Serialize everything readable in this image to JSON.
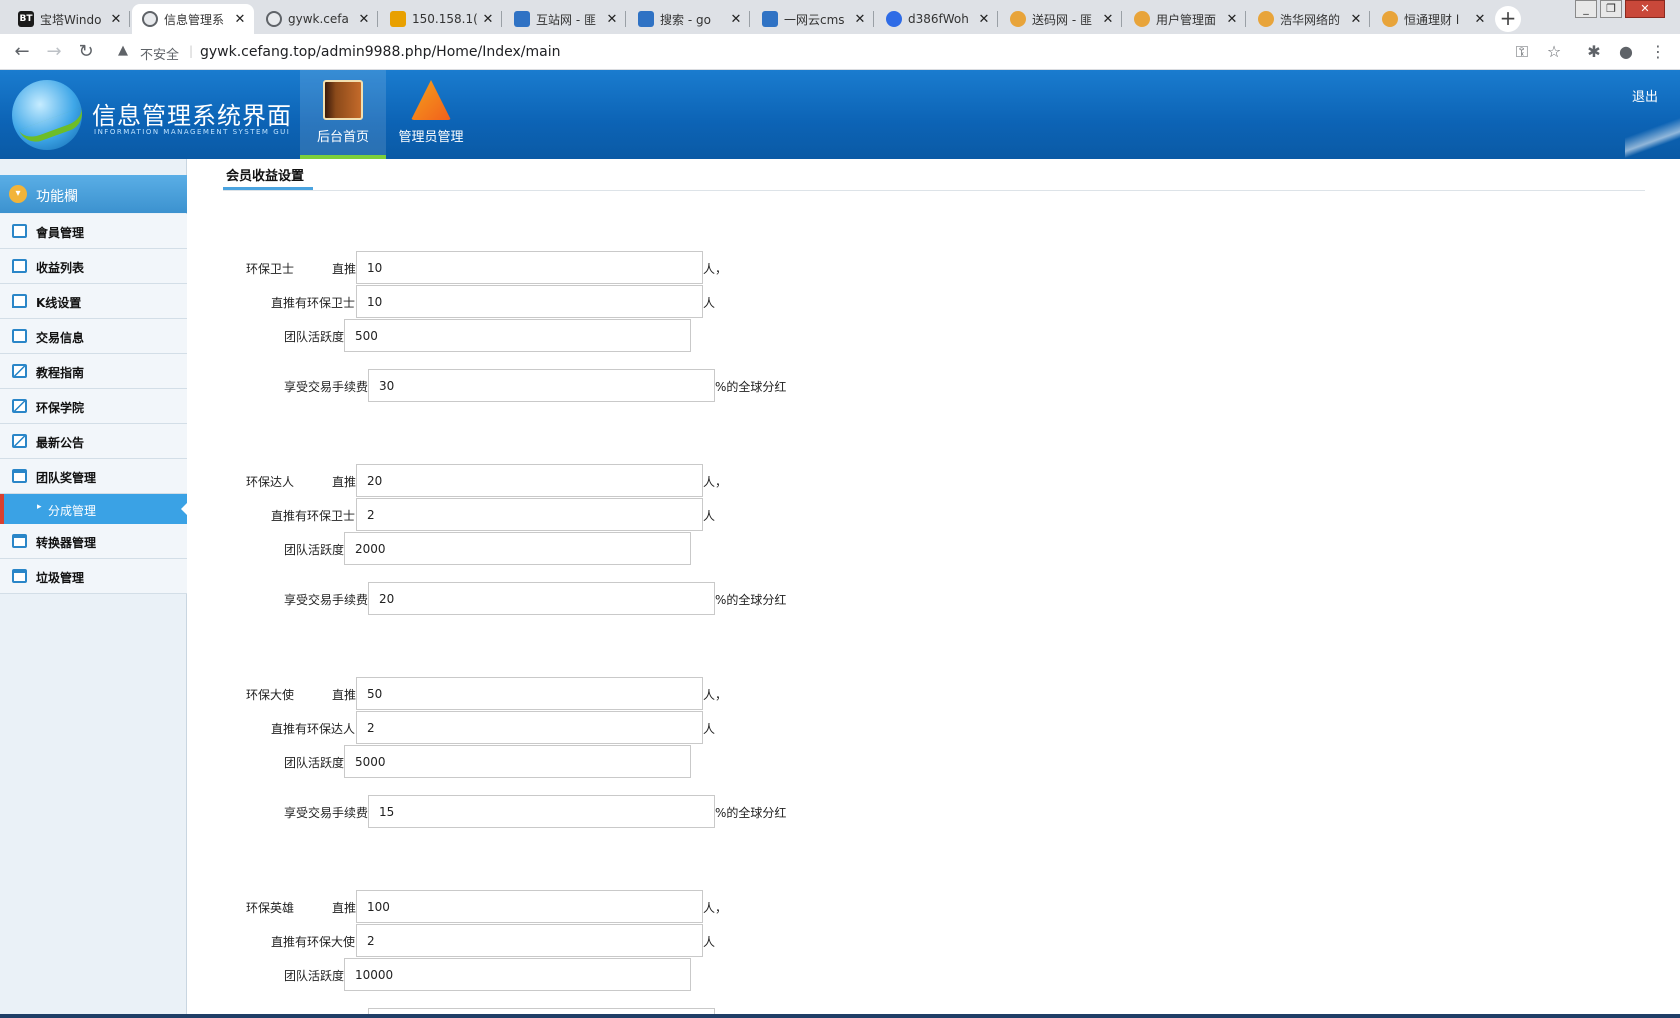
{
  "browser": {
    "tabs": [
      {
        "title": "宝塔Windo",
        "favicon": "BT",
        "color": "#1a1a1a"
      },
      {
        "title": "信息管理系",
        "favicon": "",
        "color": "#5f6368"
      },
      {
        "title": "gywk.cefa",
        "favicon": "",
        "color": "#5f6368"
      },
      {
        "title": "150.158.1(",
        "favicon": "",
        "color": "#e8a000"
      },
      {
        "title": "互站网 - 匪",
        "favicon": "",
        "color": "#2f72c4"
      },
      {
        "title": "搜索 - go",
        "favicon": "",
        "color": "#2f72c4"
      },
      {
        "title": "一网云cms",
        "favicon": "",
        "color": "#2f72c4"
      },
      {
        "title": "d386fWoh",
        "favicon": "",
        "color": "#2e6be6"
      },
      {
        "title": "送码网 - 匪",
        "favicon": "",
        "color": "#e8a43a"
      },
      {
        "title": "用户管理面",
        "favicon": "",
        "color": "#e8a43a"
      },
      {
        "title": "浩华网络的",
        "favicon": "",
        "color": "#e8a43a"
      },
      {
        "title": "恒通理财 l",
        "favicon": "",
        "color": "#e8a43a"
      }
    ],
    "new_tab": "+",
    "security_label": "不安全",
    "url": "gywk.cefang.top/admin9988.php/Home/Index/main"
  },
  "header": {
    "title": "信息管理系统界面",
    "subtitle": "INFORMATION MANAGEMENT SYSTEM GUI",
    "nav": [
      {
        "label": "后台首页",
        "icon": "book-icon"
      },
      {
        "label": "管理员管理",
        "icon": "tools-icon"
      }
    ],
    "logout": "退出"
  },
  "sidebar": {
    "heading": "功能欄",
    "items": [
      {
        "label": "會員管理",
        "icon": "list-icon"
      },
      {
        "label": "收益列表",
        "icon": "comment-icon"
      },
      {
        "label": "K线设置",
        "icon": "comment-icon"
      },
      {
        "label": "交易信息",
        "icon": "list-icon"
      },
      {
        "label": "教程指南",
        "icon": "edit-icon"
      },
      {
        "label": "环保学院",
        "icon": "edit-icon"
      },
      {
        "label": "最新公告",
        "icon": "edit-icon"
      },
      {
        "label": "团队奖管理",
        "icon": "calendar-icon"
      },
      {
        "label": "转换器管理",
        "icon": "calendar-icon"
      },
      {
        "label": "垃圾管理",
        "icon": "calendar-icon"
      }
    ],
    "sub_item": "分成管理"
  },
  "main": {
    "page_title": "会员收益设置",
    "groups": [
      {
        "level": "环保卫士",
        "direct_label": "直推",
        "direct": "10",
        "direct_suffix": "人，",
        "sub_label": "直推有环保卫士",
        "sub": "10",
        "sub_suffix": "人",
        "team_label": "团队活跃度",
        "team": "500",
        "fee_label": "享受交易手续费",
        "fee": "30",
        "fee_suffix": "%的全球分红"
      },
      {
        "level": "环保达人",
        "direct_label": "直推",
        "direct": "20",
        "direct_suffix": "人，",
        "sub_label": "直推有环保卫士",
        "sub": "2",
        "sub_suffix": "人",
        "team_label": "团队活跃度",
        "team": "2000",
        "fee_label": "享受交易手续费",
        "fee": "20",
        "fee_suffix": "%的全球分红"
      },
      {
        "level": "环保大使",
        "direct_label": "直推",
        "direct": "50",
        "direct_suffix": "人，",
        "sub_label": "直推有环保达人",
        "sub": "2",
        "sub_suffix": "人",
        "team_label": "团队活跃度",
        "team": "5000",
        "fee_label": "享受交易手续费",
        "fee": "15",
        "fee_suffix": "%的全球分红"
      },
      {
        "level": "环保英雄",
        "direct_label": "直推",
        "direct": "100",
        "direct_suffix": "人，",
        "sub_label": "直推有环保大使",
        "sub": "2",
        "sub_suffix": "人",
        "team_label": "团队活跃度",
        "team": "10000"
      }
    ]
  }
}
